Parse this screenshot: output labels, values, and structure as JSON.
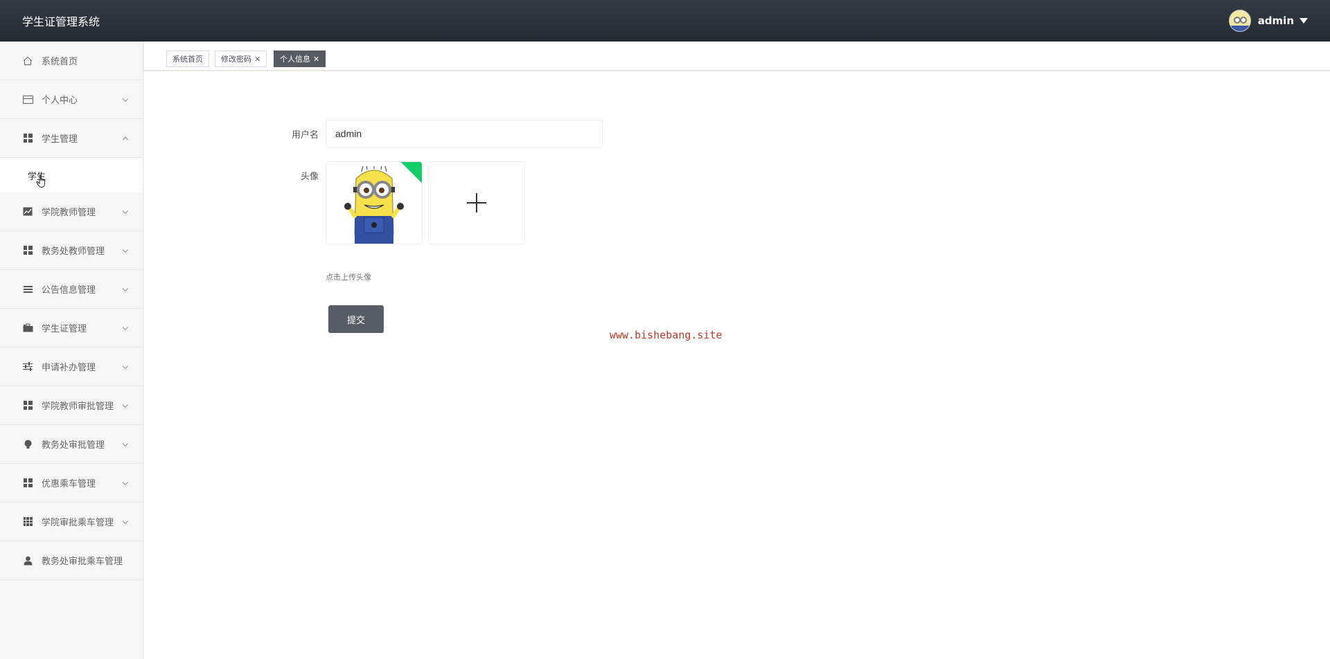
{
  "header": {
    "title": "学生证管理系统",
    "username": "admin"
  },
  "sidebar": {
    "items": [
      {
        "label": "系统首页",
        "icon": "home-icon"
      },
      {
        "label": "个人中心",
        "icon": "card-icon"
      },
      {
        "label": "学生管理",
        "icon": "grid-icon",
        "expanded": true
      },
      {
        "label": "学院教师管理",
        "icon": "chart-icon"
      },
      {
        "label": "教务处教师管理",
        "icon": "grid-icon"
      },
      {
        "label": "公告信息管理",
        "icon": "list-icon"
      },
      {
        "label": "学生证管理",
        "icon": "briefcase-icon"
      },
      {
        "label": "申请补办管理",
        "icon": "sliders-icon"
      },
      {
        "label": "学院教师审批管理",
        "icon": "grid-icon"
      },
      {
        "label": "教务处审批管理",
        "icon": "bulb-icon"
      },
      {
        "label": "优惠乘车管理",
        "icon": "grid-icon"
      },
      {
        "label": "学院审批乘车管理",
        "icon": "apps-icon"
      },
      {
        "label": "教务处审批乘车管理",
        "icon": "user-icon"
      }
    ],
    "submenu": {
      "label": "学生"
    }
  },
  "tabs": [
    {
      "label": "系统首页",
      "closable": false
    },
    {
      "label": "修改密码",
      "closable": true
    },
    {
      "label": "个人信息",
      "closable": true,
      "active": true
    }
  ],
  "tab_close_glyph": "✕",
  "form": {
    "username_label": "用户名",
    "username_value": "admin",
    "avatar_label": "头像",
    "upload_tip": "点击上传头像",
    "submit_label": "提交"
  },
  "watermark": "www.bishebang.site",
  "colors": {
    "header_bg": "#2b323b",
    "active_tab": "#545b62",
    "success": "#13ce66",
    "watermark": "#c0392b"
  }
}
